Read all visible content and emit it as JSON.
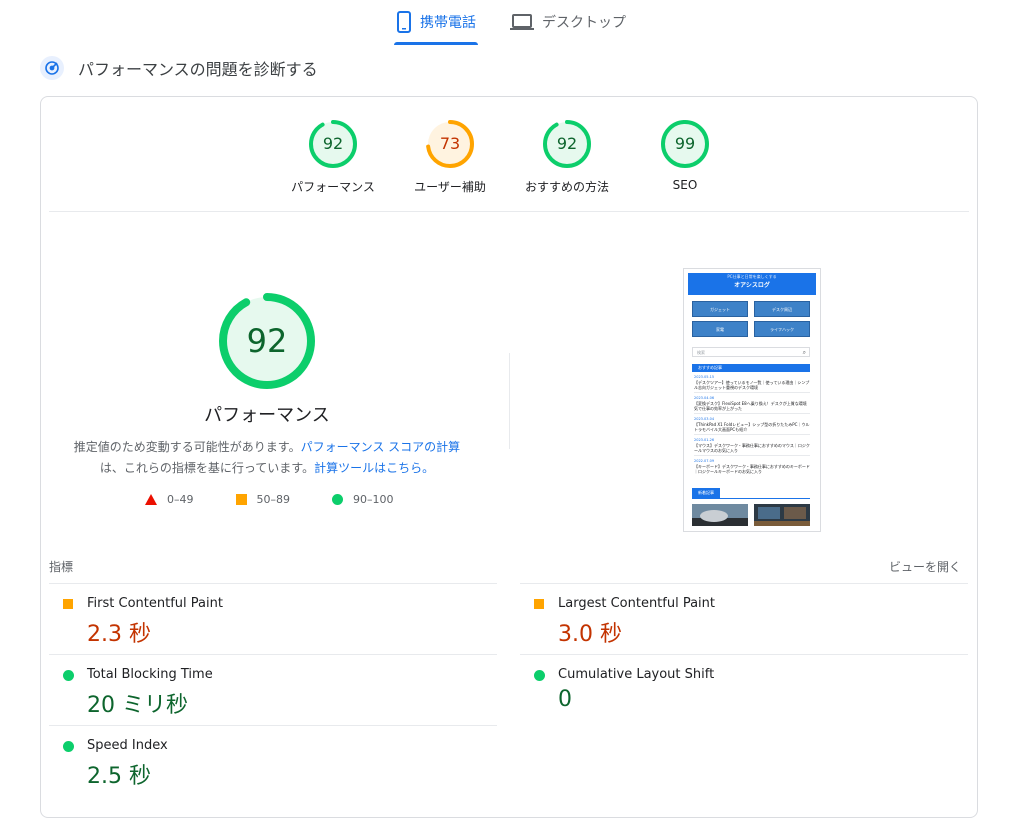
{
  "tabs": [
    {
      "label": "携帯電話",
      "icon": "mobile-phone-icon",
      "active": true
    },
    {
      "label": "デスクトップ",
      "icon": "laptop-icon",
      "active": false
    }
  ],
  "header": {
    "title": "パフォーマンスの問題を診断する",
    "icon": "diagnose-icon"
  },
  "categories": [
    {
      "score": "92",
      "label": "パフォーマンス",
      "score_value": 92,
      "color": "#0cce6b"
    },
    {
      "score": "73",
      "label": "ユーザー補助",
      "score_value": 73,
      "color": "#ffa400"
    },
    {
      "score": "92",
      "label": "おすすめの方法",
      "score_value": 92,
      "color": "#0cce6b"
    },
    {
      "score": "99",
      "label": "SEO",
      "score_value": 99,
      "color": "#0cce6b"
    }
  ],
  "main_score": {
    "score": "92",
    "score_value": 92,
    "title": "パフォーマンス",
    "desc_1": "推定値のため変動する可能性があります。",
    "link_1": "パフォーマンス スコアの計算",
    "desc_2": "は、これらの指標を基に行っています。",
    "link_2": "計算ツールはこちら。"
  },
  "legend": [
    {
      "range": "0–49",
      "shape": "triangle",
      "color": "#eb0f00"
    },
    {
      "range": "50–89",
      "shape": "square",
      "color": "#ffa400"
    },
    {
      "range": "90–100",
      "shape": "circle",
      "color": "#0cce6b"
    }
  ],
  "screenshot": {
    "subtitle": "PC仕事と日常を楽しくする",
    "title": "オアシスログ",
    "buttons": [
      "ガジェット",
      "デスク周辺",
      "家電",
      "ライフハック"
    ],
    "search_placeholder": "検索",
    "section_label": "おすすめ記事",
    "posts": [
      {
        "date": "2023.05.15",
        "title": "【デスクツアー】使っているモノ一覧｜使っている理由｜シンプル志向ガジェット重視のデスク環境"
      },
      {
        "date": "2023.04.06",
        "title": "【変換デスク】FlexiSpot E8へ乗り換え！デスクが上質な環境気で仕事の効率が上がった"
      },
      {
        "date": "2023.03.04",
        "title": "【ThinkPad X1 Foldレビュー】シップ型の折りたたみPC｜ウルトラモバイル大画面PCも紹介"
      },
      {
        "date": "2023.01.26",
        "title": "【マウス】デスクワーク・事務仕事におすすめのマウス｜ロジクールマウスのお気に入り"
      },
      {
        "date": "2022.07.09",
        "title": "【キーボード】デスクワーク・事務仕事におすすめのキーボード｜ロジクールキーボードのお気に入り"
      }
    ],
    "tag_label": "新着記事"
  },
  "metrics": {
    "label": "指標",
    "expand_label": "ビューを開く",
    "items": [
      {
        "name": "First Contentful Paint",
        "value": "2.3 秒",
        "status": "average"
      },
      {
        "name": "Largest Contentful Paint",
        "value": "3.0 秒",
        "status": "average"
      },
      {
        "name": "Total Blocking Time",
        "value": "20 ミリ秒",
        "status": "good"
      },
      {
        "name": "Cumulative Layout Shift",
        "value": "0",
        "status": "good"
      },
      {
        "name": "Speed Index",
        "value": "2.5 秒",
        "status": "good"
      }
    ]
  }
}
